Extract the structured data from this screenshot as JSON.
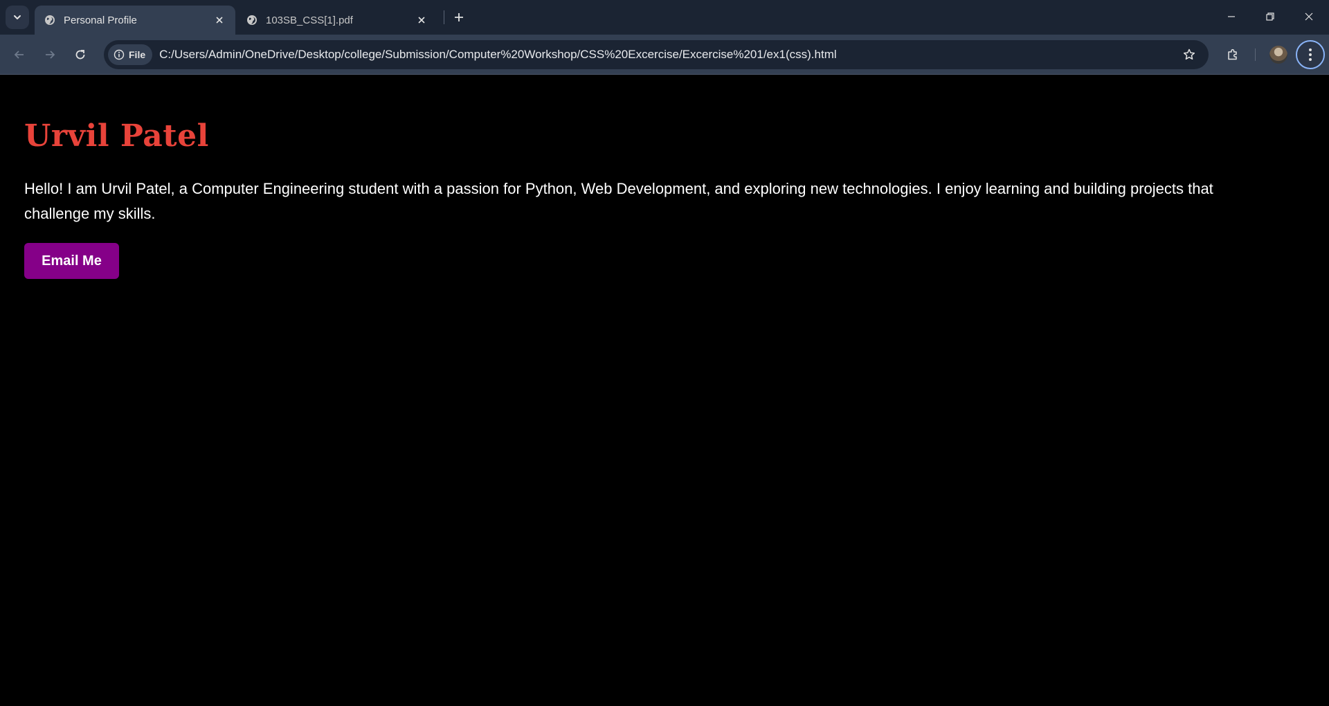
{
  "browser": {
    "tabs": [
      {
        "title": "Personal Profile",
        "active": true
      },
      {
        "title": "103SB_CSS[1].pdf",
        "active": false
      }
    ],
    "address": {
      "chip_label": "File",
      "url": "C:/Users/Admin/OneDrive/Desktop/college/Submission/Computer%20Workshop/CSS%20Excercise/Excercise%201/ex1(css).html"
    }
  },
  "page": {
    "name": "Urvil Patel",
    "bio": "Hello! I am Urvil Patel, a Computer Engineering student with a passion for Python, Web Development, and exploring new technologies. I enjoy learning and building projects that challenge my skills.",
    "button_label": "Email Me"
  },
  "colors": {
    "name_color": "#e8433a",
    "button_bg": "#850088",
    "page_bg": "#000000",
    "tabstrip_bg": "#1b2433",
    "toolbar_bg": "#333f52"
  }
}
